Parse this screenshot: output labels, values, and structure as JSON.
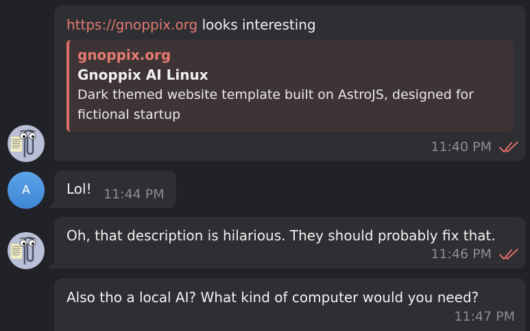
{
  "colors": {
    "background": "#212227",
    "bubble": "#2e2f33",
    "link": "#e57a72",
    "preview_bar": "#e06e68",
    "read_check": "#e06e68",
    "timestamp": "#8b8d93"
  },
  "messages": [
    {
      "avatar": "clippy-avatar",
      "link_text": "https://gnoppix.org",
      "text": " looks interesting",
      "preview": {
        "site": "gnoppix.org",
        "title": "Gnoppix AI Linux",
        "description": "Dark themed website template built on AstroJS, designed for fictional startup"
      },
      "time": "11:40 PM",
      "status_icon": "double-check-icon"
    },
    {
      "avatar_initial": "A",
      "text": "Lol!",
      "time": "11:44 PM"
    },
    {
      "avatar": "clippy-avatar",
      "text": "Oh, that description is hilarious.  They should probably fix that.",
      "time": "11:46 PM",
      "status_icon": "double-check-icon"
    },
    {
      "text": "Also tho a local AI? What kind of computer would you need?",
      "time": "11:47 PM"
    }
  ]
}
